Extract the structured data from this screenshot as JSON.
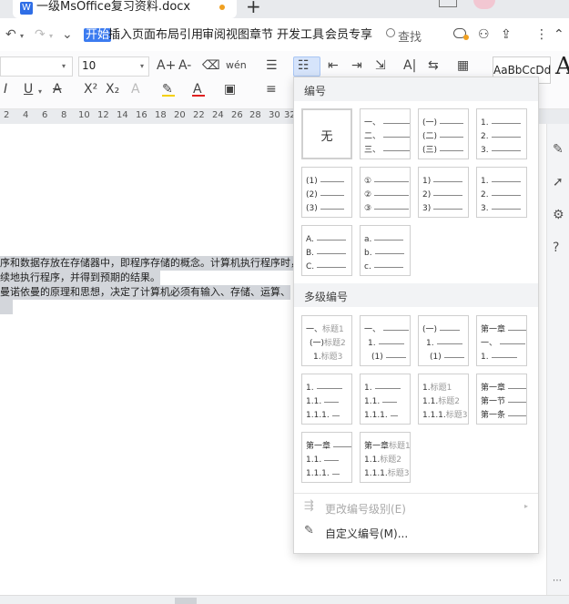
{
  "window": {
    "doc_title": "一级MsOffice复习资料.docx",
    "new_tab": "+"
  },
  "menu": {
    "items": [
      "开始",
      "插入",
      "页面布局",
      "引用",
      "审阅",
      "视图",
      "章节",
      "开发工具",
      "会员专享"
    ],
    "search": "查找",
    "undo_icon": "↶",
    "redo_icon": "↷",
    "more_icon": "⌄"
  },
  "ribbon": {
    "font_size": "10",
    "style_preview": "AaBbCcDd",
    "style_big": "A",
    "row1_icons": [
      "A+",
      "A-",
      "⌫",
      "wén",
      "☰",
      "☷",
      "⇤",
      "⇥",
      "⇲",
      "A|",
      "⇆",
      "▦"
    ],
    "row2_icons": [
      "I",
      "U",
      "A",
      "X²",
      "X₂",
      "A",
      "✎",
      "A",
      "▣",
      "≡"
    ]
  },
  "ruler": [
    "2",
    "4",
    "6",
    "8",
    "10",
    "12",
    "14",
    "16",
    "18",
    "20",
    "22",
    "24",
    "26",
    "28",
    "30",
    "32"
  ],
  "document": {
    "lines": [
      "序和数据存放在存储器中，即程序存储的概念。计算机执行程序时，无",
      "续地执行程序，并得到预期的结果。",
      "曼诺依曼的原理和思想，决定了计算机必须有输入、存储、运算、",
      ""
    ]
  },
  "dropdown": {
    "section_numbering": "编号",
    "section_multilevel": "多级编号",
    "none_label": "无",
    "simple_cells": [
      [
        "一、",
        "二、",
        "三、"
      ],
      [
        "(一)",
        "(二)",
        "(三)"
      ],
      [
        "1.",
        "2.",
        "3."
      ],
      [
        "(1)",
        "(2)",
        "(3)"
      ],
      [
        "①",
        "②",
        "③"
      ],
      [
        "1)",
        "2)",
        "3)"
      ],
      [
        "1.",
        "2.",
        "3."
      ],
      [
        "A.",
        "B.",
        "C."
      ],
      [
        "a.",
        "b.",
        "c."
      ]
    ],
    "multilevel_cells": [
      [
        [
          "一、",
          "标题1"
        ],
        [
          "(一)",
          "标题2"
        ],
        [
          "1.",
          "标题3"
        ]
      ],
      [
        [
          "一、",
          ""
        ],
        [
          "1.",
          ""
        ],
        [
          "(1)",
          ""
        ]
      ],
      [
        [
          "(一)",
          ""
        ],
        [
          "1.",
          ""
        ],
        [
          "(1)",
          ""
        ]
      ],
      [
        [
          "第一章",
          ""
        ],
        [
          "一、",
          ""
        ],
        [
          "1.",
          ""
        ]
      ],
      [
        [
          "1.",
          ""
        ],
        [
          "1.1.",
          ""
        ],
        [
          "1.1.1.",
          ""
        ]
      ],
      [
        [
          "1.",
          ""
        ],
        [
          "1.1.",
          ""
        ],
        [
          "1.1.1.",
          ""
        ]
      ],
      [
        [
          "1.",
          "标题1"
        ],
        [
          "1.1.",
          "标题2"
        ],
        [
          "1.1.1.",
          "标题3"
        ]
      ],
      [
        [
          "第一章",
          ""
        ],
        [
          "第一节",
          ""
        ],
        [
          "第一条",
          ""
        ]
      ],
      [
        [
          "第一章",
          ""
        ],
        [
          "1.1.",
          ""
        ],
        [
          "1.1.1.",
          ""
        ]
      ],
      [
        [
          "第一章",
          "标题1"
        ],
        [
          "1.1.",
          "标题2"
        ],
        [
          "1.1.1.",
          "标题3"
        ]
      ]
    ],
    "change_level": "更改编号级别(E)",
    "custom": "自定义编号(M)..."
  }
}
